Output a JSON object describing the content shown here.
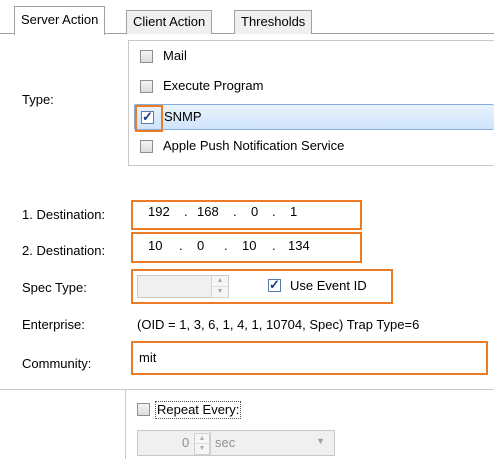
{
  "tabs": [
    "Server Action",
    "Client Action",
    "Thresholds"
  ],
  "type_label": "Type:",
  "type_options": [
    {
      "label": "Mail",
      "checked": false
    },
    {
      "label": "Execute Program",
      "checked": false
    },
    {
      "label": "SNMP",
      "checked": true
    },
    {
      "label": "Apple Push Notification Service",
      "checked": false
    }
  ],
  "destination1": {
    "label": "1. Destination:",
    "octets": [
      "192",
      "168",
      "0",
      "1"
    ]
  },
  "destination2": {
    "label": "2. Destination:",
    "octets": [
      "10",
      "0",
      "10",
      "134"
    ]
  },
  "spec_type": {
    "label": "Spec Type:",
    "value": "",
    "use_event_id_label": "Use Event ID",
    "use_event_id_checked": true
  },
  "enterprise": {
    "label": "Enterprise:",
    "value": "(OID = 1, 3, 6, 1, 4, 1, 10704, Spec)  Trap Type=6"
  },
  "community": {
    "label": "Community:",
    "value": "mit"
  },
  "repeat": {
    "label": "Repeat Every:",
    "checked": false,
    "value": "0",
    "unit": "sec"
  },
  "colors": {
    "highlight": "#ec7b25",
    "selection": "#cfe4fb"
  }
}
